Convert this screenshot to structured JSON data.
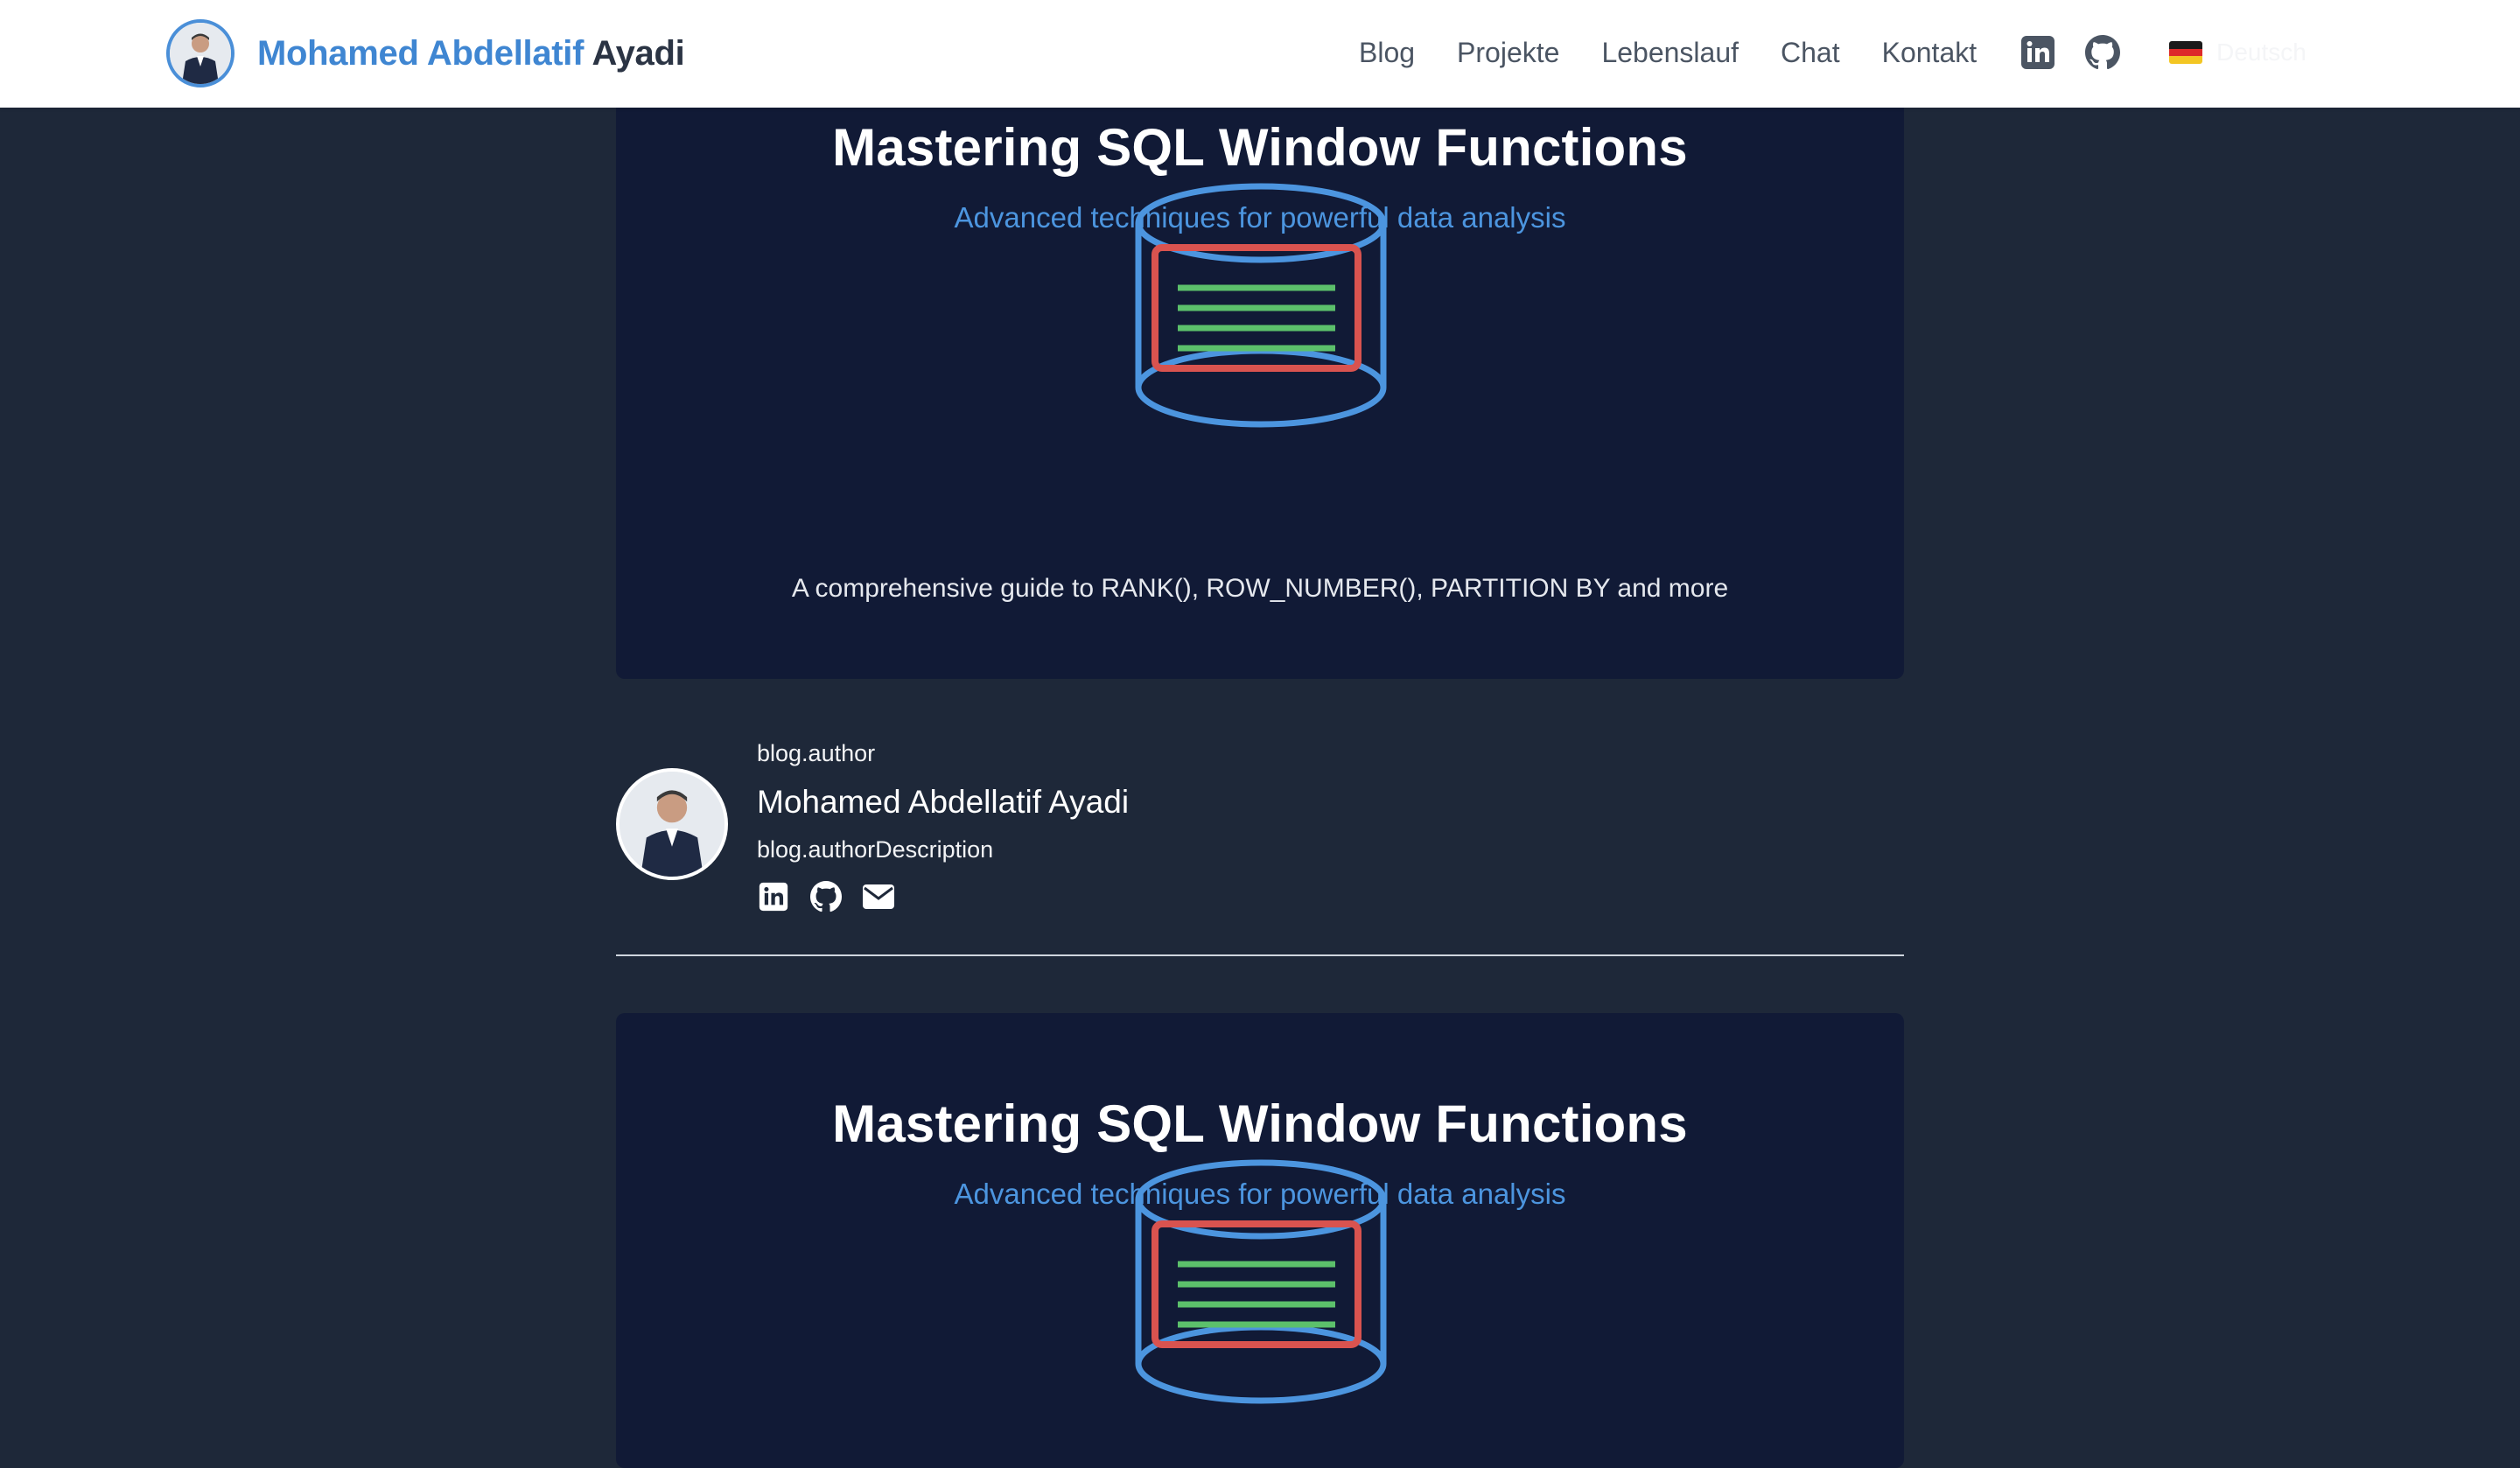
{
  "header": {
    "brand_first": "Mohamed Abdellatif",
    "brand_last": "Ayadi",
    "nav": {
      "blog": "Blog",
      "projects": "Projekte",
      "cv": "Lebenslauf",
      "chat": "Chat",
      "contact": "Kontakt"
    },
    "language": "Deutsch",
    "icons": [
      "linkedin-icon",
      "github-icon",
      "german-flag-icon"
    ]
  },
  "card_top": {
    "title": "Mastering SQL Window Functions",
    "subtitle": "Advanced techniques for powerful data analysis",
    "description": "A comprehensive guide to RANK(), ROW_NUMBER(), PARTITION BY and more"
  },
  "author": {
    "heading": "blog.author",
    "name": "Mohamed Abdellatif Ayadi",
    "description": "blog.authorDescription",
    "icons": [
      "linkedin-icon",
      "github-icon",
      "mail-icon"
    ]
  },
  "card_bottom": {
    "title": "Mastering SQL Window Functions",
    "subtitle": "Advanced techniques for powerful data analysis"
  },
  "colors": {
    "page_bg": "#1e2839",
    "card_bg": "#111a36",
    "accent_blue": "#4c95df",
    "db_red": "#d9534f",
    "db_green": "#5cc06b"
  }
}
